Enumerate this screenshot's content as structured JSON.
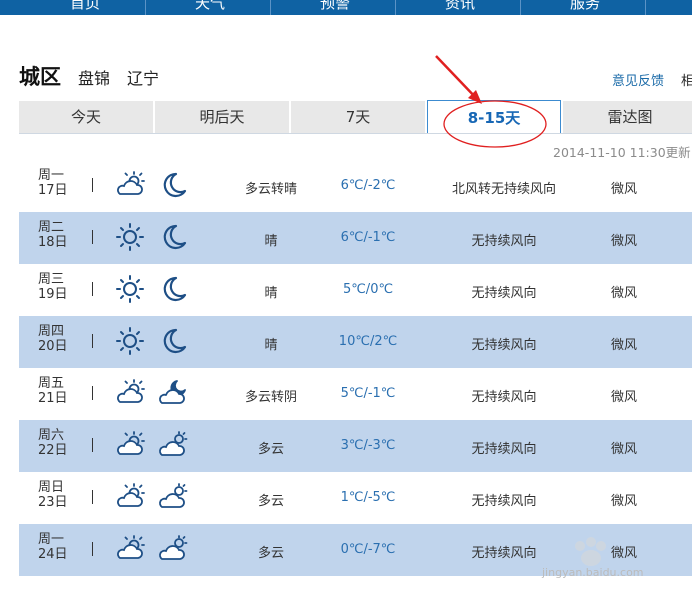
{
  "nav": {
    "items": [
      "首页",
      "天气",
      "预警",
      "资讯",
      "服务"
    ]
  },
  "location": {
    "city": "城区",
    "region": "盘锦",
    "province": "辽宁"
  },
  "header": {
    "feedback": "意见反馈",
    "cut_text": "相"
  },
  "tabs": [
    "今天",
    "明后天",
    "7天",
    "8-15天",
    "雷达图"
  ],
  "active_tab": "8-15天",
  "update_time": "2014-11-10 11:30更新",
  "colors": {
    "nav_bg": "#0f62a3",
    "alt_row": "#c0d4ec",
    "temp_text": "#2a6fb0",
    "active_tab": "#1767b5",
    "annotation": "#e02020"
  },
  "forecast": [
    {
      "weekday": "周一",
      "date": "17日",
      "icon_day": "partly-cloudy-icon",
      "icon_night": "moon-icon",
      "desc": "多云转晴",
      "temp": "6℃/-2℃",
      "wind": "北风转无持续风向",
      "level": "微风"
    },
    {
      "weekday": "周二",
      "date": "18日",
      "icon_day": "sun-icon",
      "icon_night": "moon-icon",
      "desc": "晴",
      "temp": "6℃/-1℃",
      "wind": "无持续风向",
      "level": "微风"
    },
    {
      "weekday": "周三",
      "date": "19日",
      "icon_day": "sun-icon",
      "icon_night": "moon-icon",
      "desc": "晴",
      "temp": "5℃/0℃",
      "wind": "无持续风向",
      "level": "微风"
    },
    {
      "weekday": "周四",
      "date": "20日",
      "icon_day": "sun-icon",
      "icon_night": "moon-icon",
      "desc": "晴",
      "temp": "10℃/2℃",
      "wind": "无持续风向",
      "level": "微风"
    },
    {
      "weekday": "周五",
      "date": "21日",
      "icon_day": "partly-cloudy-icon",
      "icon_night": "cloudy-night-icon",
      "desc": "多云转阴",
      "temp": "5℃/-1℃",
      "wind": "无持续风向",
      "level": "微风"
    },
    {
      "weekday": "周六",
      "date": "22日",
      "icon_day": "partly-cloudy-icon",
      "icon_night": "cloud-sun-icon",
      "desc": "多云",
      "temp": "3℃/-3℃",
      "wind": "无持续风向",
      "level": "微风"
    },
    {
      "weekday": "周日",
      "date": "23日",
      "icon_day": "partly-cloudy-icon",
      "icon_night": "cloud-sun-icon",
      "desc": "多云",
      "temp": "1℃/-5℃",
      "wind": "无持续风向",
      "level": "微风"
    },
    {
      "weekday": "周一",
      "date": "24日",
      "icon_day": "partly-cloudy-icon",
      "icon_night": "cloud-sun-icon",
      "desc": "多云",
      "temp": "0℃/-7℃",
      "wind": "无持续风向",
      "level": "微风"
    }
  ],
  "watermark": {
    "brand": "Baidu经验",
    "url": "jingyan.baidu.com"
  }
}
